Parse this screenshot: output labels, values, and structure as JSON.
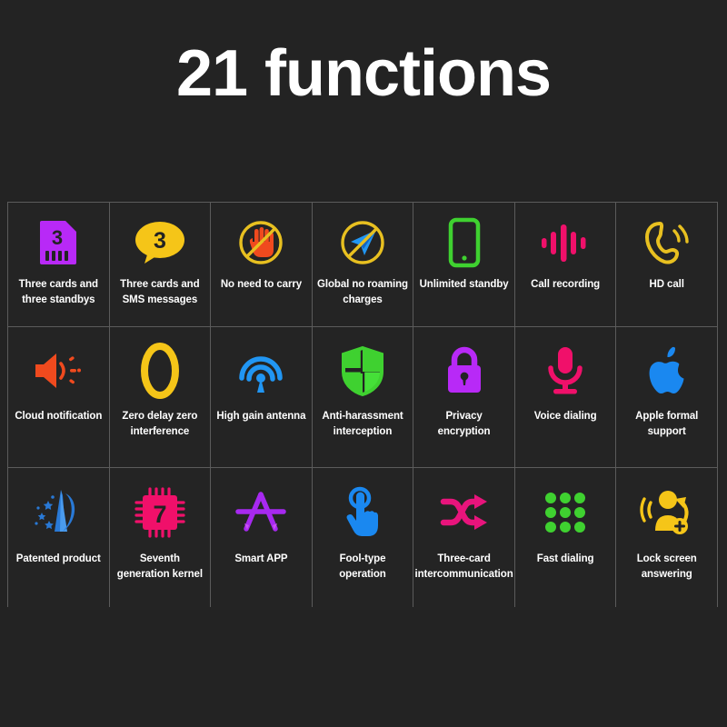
{
  "header": {
    "title": "21 functions"
  },
  "colors": {
    "background": "#232323",
    "cell_background": "#242424",
    "grid_line": "#5b5b5b",
    "text": "#ffffff",
    "purple": "#b829f7",
    "yellow": "#f5c518",
    "orange_red": "#f04a1e",
    "blue": "#2196f3",
    "green": "#3fd130",
    "pink": "#f0106a",
    "magenta": "#e8147c",
    "gold": "#e8c020",
    "violet": "#a729f0",
    "bright_blue": "#1a88f0"
  },
  "grid": {
    "columns": 7,
    "rows": 3,
    "cells": [
      {
        "label": "Three cards and three standbys",
        "icon": "sim-card-three-icon",
        "badge": "3",
        "color": "#b829f7"
      },
      {
        "label": "Three cards and SMS messages",
        "icon": "speech-bubble-three-icon",
        "badge": "3",
        "color": "#f5c518"
      },
      {
        "label": "No need to carry",
        "icon": "no-hand-icon",
        "color": "#f04a1e"
      },
      {
        "label": "Global no roaming charges",
        "icon": "no-paper-plane-icon",
        "color": "#2196f3"
      },
      {
        "label": "Unlimited standby",
        "icon": "smartphone-icon",
        "color": "#3fd130"
      },
      {
        "label": "Call recording",
        "icon": "waveform-icon",
        "color": "#f0106a"
      },
      {
        "label": "HD call",
        "icon": "phone-handset-waves-icon",
        "color": "#e8c020"
      },
      {
        "label": "Cloud notification",
        "icon": "speaker-horn-icon",
        "color": "#f04a1e"
      },
      {
        "label": "Zero delay zero interference",
        "icon": "zero-digit-icon",
        "badge": "0",
        "color": "#f5c518"
      },
      {
        "label": "High gain antenna",
        "icon": "antenna-signal-icon",
        "color": "#2196f3"
      },
      {
        "label": "Anti-harassment interception",
        "icon": "shield-icon",
        "color": "#3fd130"
      },
      {
        "label": "Privacy encryption",
        "icon": "padlock-icon",
        "color": "#b829f7"
      },
      {
        "label": "Voice dialing",
        "icon": "microphone-icon",
        "color": "#f0106a"
      },
      {
        "label": "Apple formal support",
        "icon": "apple-logo-icon",
        "color": "#1a88f0"
      },
      {
        "label": "Patented product",
        "icon": "patent-rocket-stars-icon",
        "color": "#2979d6"
      },
      {
        "label": "Seventh generation kernel",
        "icon": "cpu-chip-seven-icon",
        "badge": "7",
        "color": "#f0106a"
      },
      {
        "label": "Smart APP",
        "icon": "app-store-icon",
        "color": "#a729f0"
      },
      {
        "label": "Fool-type operation",
        "icon": "tap-hand-icon",
        "color": "#1a88f0"
      },
      {
        "label": "Three-card intercommunication",
        "icon": "shuffle-arrows-icon",
        "color": "#e8147c"
      },
      {
        "label": "Fast dialing",
        "icon": "dialpad-dots-icon",
        "color": "#3fd130"
      },
      {
        "label": "Lock screen answering",
        "icon": "person-answer-icon",
        "color": "#f5c518"
      }
    ]
  }
}
